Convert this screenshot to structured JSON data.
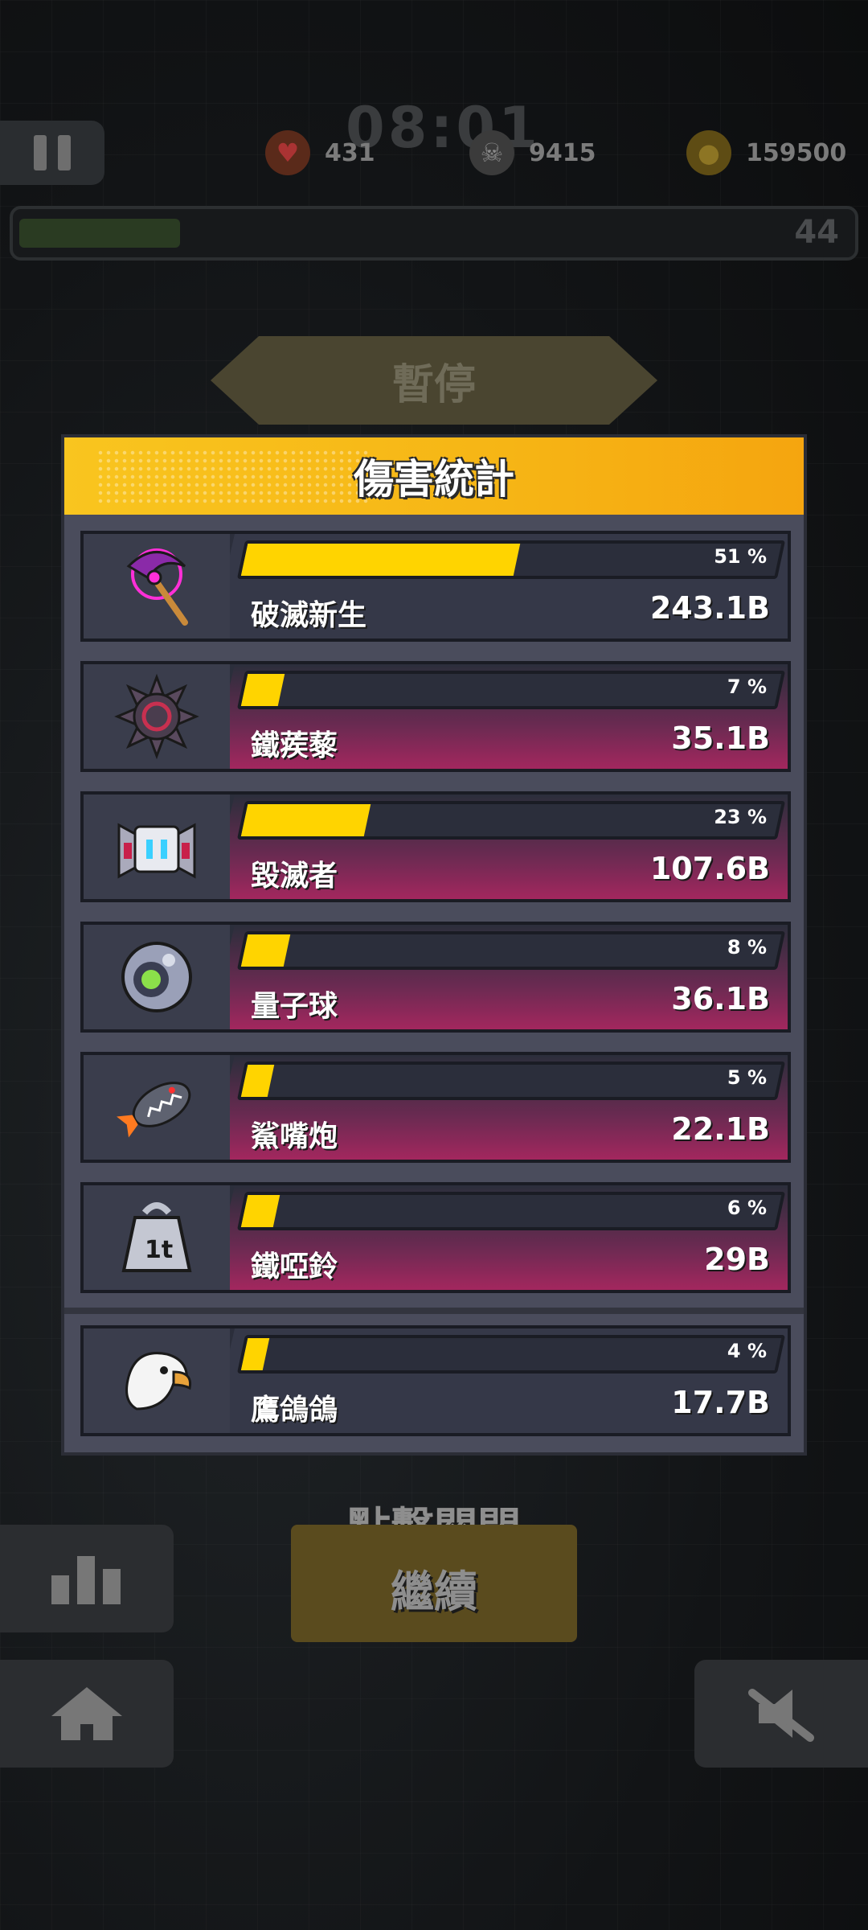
{
  "hud": {
    "timer": "08:01",
    "hearts": "431",
    "kills": "9415",
    "coins": "159500",
    "level": "44"
  },
  "pause_ribbon": "暫停",
  "panel": {
    "title": "傷害統計",
    "rows": [
      {
        "name": "破滅新生",
        "percent_label": "51 %",
        "percent": 51,
        "damage": "243.1B",
        "icon": "scythe-icon"
      },
      {
        "name": "鐵蒺藜",
        "percent_label": "7 %",
        "percent": 7,
        "damage": "35.1B",
        "icon": "spiked-ball-icon"
      },
      {
        "name": "毀滅者",
        "percent_label": "23 %",
        "percent": 23,
        "damage": "107.6B",
        "icon": "robot-drone-icon"
      },
      {
        "name": "量子球",
        "percent_label": "8 %",
        "percent": 8,
        "damage": "36.1B",
        "icon": "quantum-orb-icon"
      },
      {
        "name": "鯊嘴炮",
        "percent_label": "5 %",
        "percent": 5,
        "damage": "22.1B",
        "icon": "shark-rocket-icon"
      },
      {
        "name": "鐵啞鈴",
        "percent_label": "6 %",
        "percent": 6,
        "damage": "29B",
        "icon": "dumbbell-weight-icon"
      },
      {
        "name": "鷹鴿鴿",
        "percent_label": "4 %",
        "percent": 4,
        "damage": "17.7B",
        "icon": "eagle-icon"
      }
    ]
  },
  "close_hint": "點擊關閉",
  "continue_label": "繼續",
  "colors": {
    "header": "#f9c51f",
    "fill": "#ffd400",
    "row_bg": "#2b2e3b",
    "row_accent": "#a3275e"
  }
}
